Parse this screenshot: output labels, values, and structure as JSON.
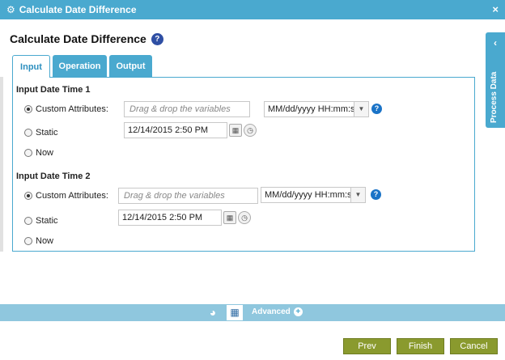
{
  "window": {
    "title": "Calculate Date Difference"
  },
  "page": {
    "heading": "Calculate Date Difference"
  },
  "tabs": [
    "Input",
    "Operation",
    "Output"
  ],
  "side_panel": {
    "label": "Process Data"
  },
  "section1": {
    "title": "Input Date Time 1",
    "radio_custom": "Custom Attributes:",
    "radio_static": "Static",
    "radio_now": "Now",
    "attr_placeholder": "Drag & drop the variables",
    "format": "MM/dd/yyyy HH:mm:ss",
    "static_value": "12/14/2015 2:50 PM"
  },
  "section2": {
    "title": "Input Date Time 2",
    "radio_custom": "Custom Attributes:",
    "radio_static": "Static",
    "radio_now": "Now",
    "attr_placeholder": "Drag & drop the variables",
    "format": "MM/dd/yyyy HH:mm:ss",
    "static_value": "12/14/2015 2:50 PM"
  },
  "bottom": {
    "advanced_label": "Advanced"
  },
  "buttons": {
    "prev": "Prev",
    "finish": "Finish",
    "cancel": "Cancel"
  },
  "colors": {
    "accent": "#4aa9cf",
    "button": "#8a9a2e",
    "help": "#1a73c7"
  }
}
